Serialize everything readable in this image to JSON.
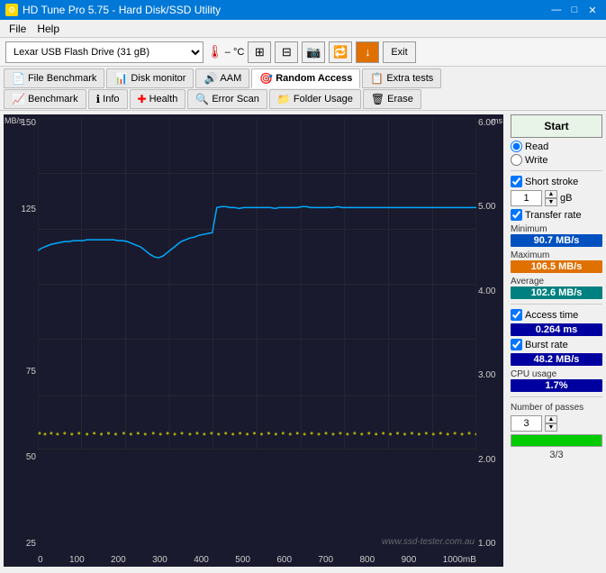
{
  "titleBar": {
    "title": "HD Tune Pro 5.75 - Hard Disk/SSD Utility",
    "minimize": "—",
    "maximize": "□",
    "close": "✕"
  },
  "menu": {
    "file": "File",
    "help": "Help"
  },
  "toolbar": {
    "driveLabel": "Lexar  USB Flash Drive (31 gB)",
    "temperature": "– °C",
    "exitLabel": "Exit"
  },
  "tabs": {
    "row1": [
      {
        "id": "file-benchmark",
        "icon": "📄",
        "label": "File Benchmark"
      },
      {
        "id": "disk-monitor",
        "icon": "📊",
        "label": "Disk monitor"
      },
      {
        "id": "aam",
        "icon": "🔊",
        "label": "AAM"
      },
      {
        "id": "random-access",
        "icon": "🎯",
        "label": "Random Access",
        "active": true
      },
      {
        "id": "extra-tests",
        "icon": "📋",
        "label": "Extra tests"
      }
    ],
    "row2": [
      {
        "id": "benchmark",
        "icon": "📈",
        "label": "Benchmark"
      },
      {
        "id": "info",
        "icon": "ℹ",
        "label": "Info"
      },
      {
        "id": "health",
        "icon": "❤",
        "label": "Health"
      },
      {
        "id": "error-scan",
        "icon": "🔍",
        "label": "Error Scan"
      },
      {
        "id": "folder-usage",
        "icon": "📁",
        "label": "Folder Usage"
      },
      {
        "id": "erase",
        "icon": "🗑",
        "label": "Erase"
      }
    ]
  },
  "chart": {
    "yLeftLabel": "MB/s",
    "yRightLabel": "ms",
    "yLeftValues": [
      "150",
      "125",
      "75",
      "50",
      "25"
    ],
    "yRightValues": [
      "6.00",
      "5.00",
      "4.00",
      "3.00",
      "2.00",
      "1.00"
    ],
    "xValues": [
      "0",
      "100",
      "200",
      "300",
      "400",
      "500",
      "600",
      "700",
      "800",
      "900",
      "1000mB"
    ],
    "watermark": "www.ssd-tester.com.au"
  },
  "rightPanel": {
    "startLabel": "Start",
    "readLabel": "Read",
    "writeLabel": "Write",
    "shortStrokeLabel": "Short stroke",
    "shortStrokeValue": "1",
    "shortStrokeUnit": "gB",
    "transferRateLabel": "Transfer rate",
    "minimumLabel": "Minimum",
    "minimumValue": "90.7 MB/s",
    "maximumLabel": "Maximum",
    "maximumValue": "106.5 MB/s",
    "averageLabel": "Average",
    "averageValue": "102.6 MB/s",
    "accessTimeLabel": "Access time",
    "accessTimeValue": "0.264 ms",
    "burstRateLabel": "Burst rate",
    "burstRateValue": "48.2 MB/s",
    "cpuUsageLabel": "CPU usage",
    "cpuUsageValue": "1.7%",
    "numberOfPassesLabel": "Number of passes",
    "numberOfPassesValue": "3",
    "progressLabel": "3/3"
  }
}
